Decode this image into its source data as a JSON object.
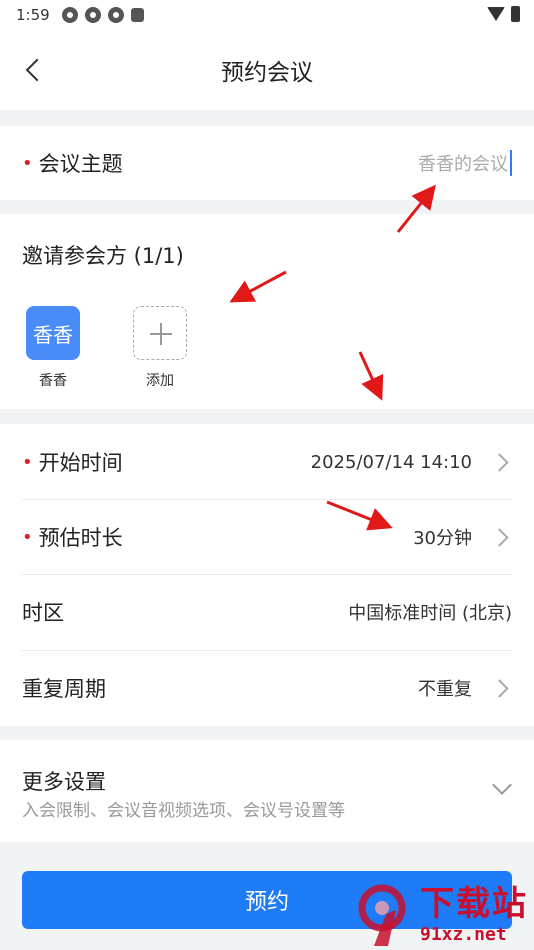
{
  "status_bar": {
    "time": "1:59"
  },
  "header": {
    "title": "预约会议"
  },
  "topic": {
    "label": "会议主题",
    "placeholder": "香香的会议"
  },
  "invite": {
    "title": "邀请参会方 (1/1)",
    "participants": [
      {
        "avatar_text": "香香",
        "name": "香香"
      }
    ],
    "add_label": "添加"
  },
  "schedule": {
    "start": {
      "label": "开始时间",
      "value": "2025/07/14 14:10"
    },
    "duration": {
      "label": "预估时长",
      "value": "30分钟"
    },
    "timezone": {
      "label": "时区",
      "value": "中国标准时间 (北京)"
    },
    "repeat": {
      "label": "重复周期",
      "value": "不重复"
    }
  },
  "more": {
    "title": "更多设置",
    "subtitle": "入会限制、会议音视频选项、会议号设置等"
  },
  "submit": {
    "label": "预约"
  },
  "watermark": {
    "name": "下载站",
    "url": "91xz.net"
  },
  "colors": {
    "primary": "#1f7cf8",
    "required": "#e02020",
    "annotation": "#e01818"
  }
}
